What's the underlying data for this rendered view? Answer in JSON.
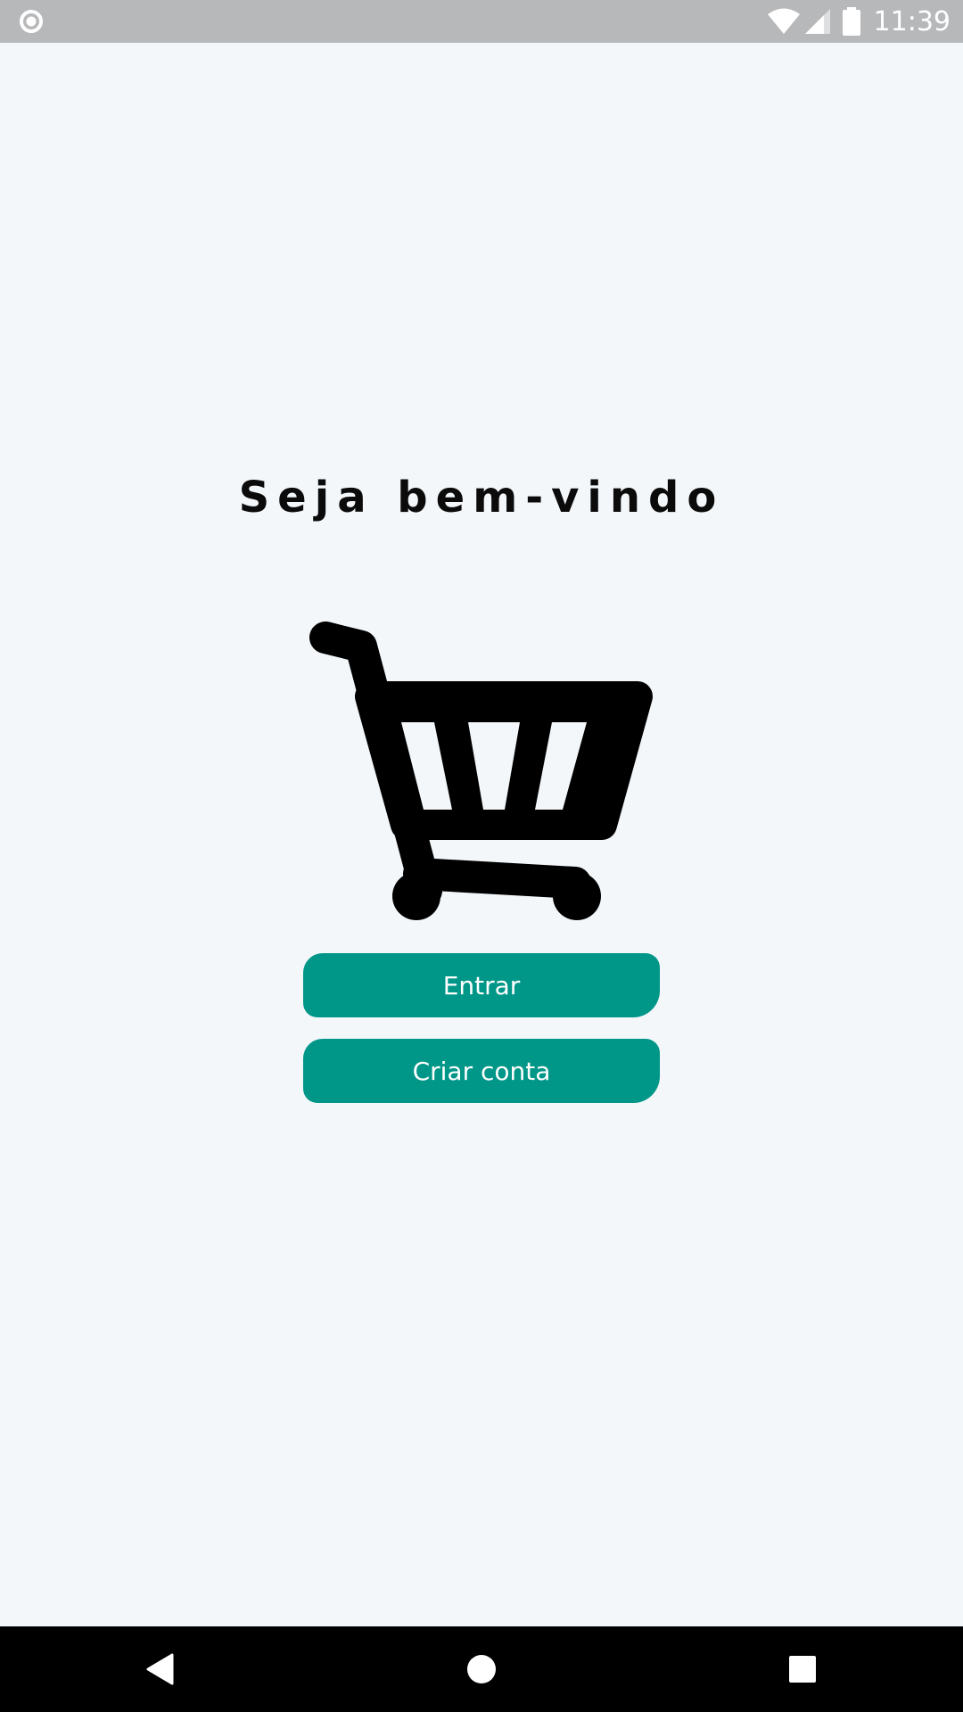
{
  "status_bar": {
    "time": "11:39",
    "icons": [
      "notification-circle-icon",
      "wifi-icon",
      "signal-icon",
      "battery-icon"
    ]
  },
  "welcome": {
    "title": "Seja bem-vindo",
    "icon": "shopping-cart-icon"
  },
  "buttons": {
    "login_label": "Entrar",
    "signup_label": "Criar conta"
  },
  "colors": {
    "background": "#f3f7fa",
    "button": "#009688",
    "status_bar": "#b7b8ba",
    "nav_bar": "#000000"
  },
  "nav_bar": {
    "icons": [
      "back-icon",
      "home-icon",
      "recent-apps-icon"
    ]
  }
}
